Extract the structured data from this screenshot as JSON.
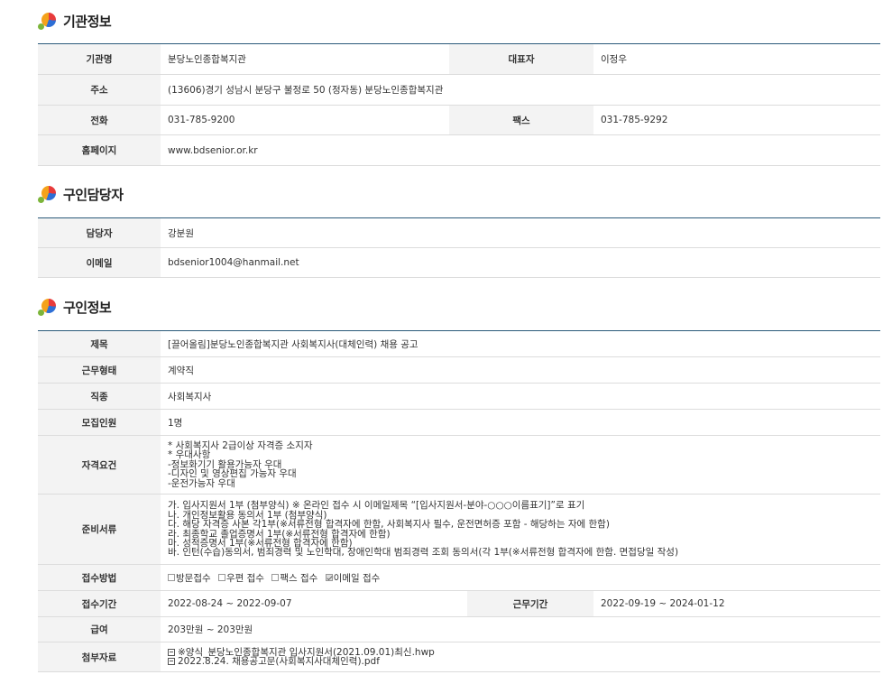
{
  "sections": {
    "org": {
      "title": "기관정보"
    },
    "contact": {
      "title": "구인담당자"
    },
    "job": {
      "title": "구인정보"
    }
  },
  "org": {
    "name_label": "기관명",
    "name": "분당노인종합복지관",
    "ceo_label": "대표자",
    "ceo": "이정우",
    "address_label": "주소",
    "address": "(13606)경기 성남시 분당구 불정로 50 (정자동) 분당노인종합복지관",
    "phone_label": "전화",
    "phone": "031-785-9200",
    "fax_label": "팩스",
    "fax": "031-785-9292",
    "homepage_label": "홈페이지",
    "homepage": "www.bdsenior.or.kr"
  },
  "contact": {
    "manager_label": "담당자",
    "manager": "강분원",
    "email_label": "이메일",
    "email": "bdsenior1004@hanmail.net"
  },
  "job": {
    "title_label": "제목",
    "title": "[끌어올림]분당노인종합복지관 사회복지사(대체인력) 채용 공고",
    "type_label": "근무형태",
    "type": "계약직",
    "category_label": "직종",
    "category": "사회복지사",
    "headcount_label": "모집인원",
    "headcount": "1명",
    "requirements_label": "자격요건",
    "requirements": [
      "* 사회복지사 2급이상 자격증 소지자",
      "* 우대사항",
      "-정보화기기 활용가능자 우대",
      "-디자인 및 영상편집 가능자 우대",
      "-운전가능자 우대"
    ],
    "documents_label": "준비서류",
    "documents": [
      "가. 입사지원서 1부 (첨부양식) ※ 온라인 접수 시 이메일제목 “[입사지원서-분야-○○○이름표기]”로 표기",
      "나. 개인정보활용 동의서 1부 (첨부양식)",
      "다. 해당 자격증 사본 각1부(※서류전형 합격자에 한함, 사회복지사 필수, 운전면허증 포함 - 해당하는 자에 한함)",
      "라. 최종학교 졸업증명서 1부(※서류전형 합격자에 한함)",
      "마. 성적증명서 1부(※서류전형 합격자에 한함)",
      "바. 인턴(수습)동의서, 범죄경력 및 노인학대, 장애인학대 범죄경력 조회 동의서(각 1부(※서류전형 합격자에 한함. 면접당일 작성)"
    ],
    "method_label": "접수방법",
    "methods": [
      {
        "label": "방문접수",
        "checked": false
      },
      {
        "label": "우편 접수",
        "checked": false
      },
      {
        "label": "팩스 접수",
        "checked": false
      },
      {
        "label": "이메일 접수",
        "checked": true
      }
    ],
    "apply_period_label": "접수기간",
    "apply_period": "2022-08-24 ~ 2022-09-07",
    "work_period_label": "근무기간",
    "work_period": "2022-09-19 ~ 2024-01-12",
    "salary_label": "급여",
    "salary": "203만원 ~ 203만원",
    "attachments_label": "첨부자료",
    "attachments": [
      "※양식_분당노인종합복지관 입사지원서(2021.09.01)최신.hwp",
      "2022.8.24. 채용공고문(사회복지사대체인력).pdf"
    ]
  }
}
